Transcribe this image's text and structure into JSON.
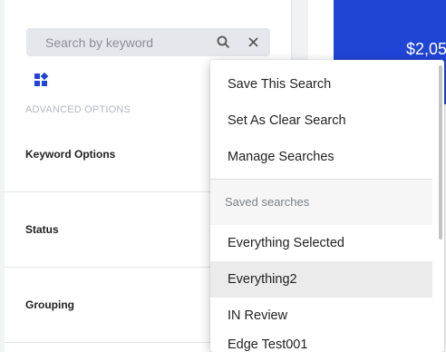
{
  "search": {
    "placeholder": "Search by keyword"
  },
  "left_panel": {
    "advanced_options_label": "ADVANCED OPTIONS",
    "rows": [
      "Keyword Options",
      "Status",
      "Grouping"
    ]
  },
  "summary_card": {
    "amount": "$2,05"
  },
  "menu": {
    "actions": [
      "Save This Search",
      "Set As Clear Search",
      "Manage Searches"
    ],
    "saved_header": "Saved searches",
    "saved": [
      "Everything Selected",
      "Everything2",
      "IN Review"
    ],
    "partial_item": "Edge Test001"
  },
  "colors": {
    "accent": "#1f44d6",
    "selected_bg": "#ebebeb",
    "panel_bg": "#f1f2f4"
  },
  "icons": [
    "search-icon",
    "close-icon",
    "filter-grid-icon"
  ]
}
